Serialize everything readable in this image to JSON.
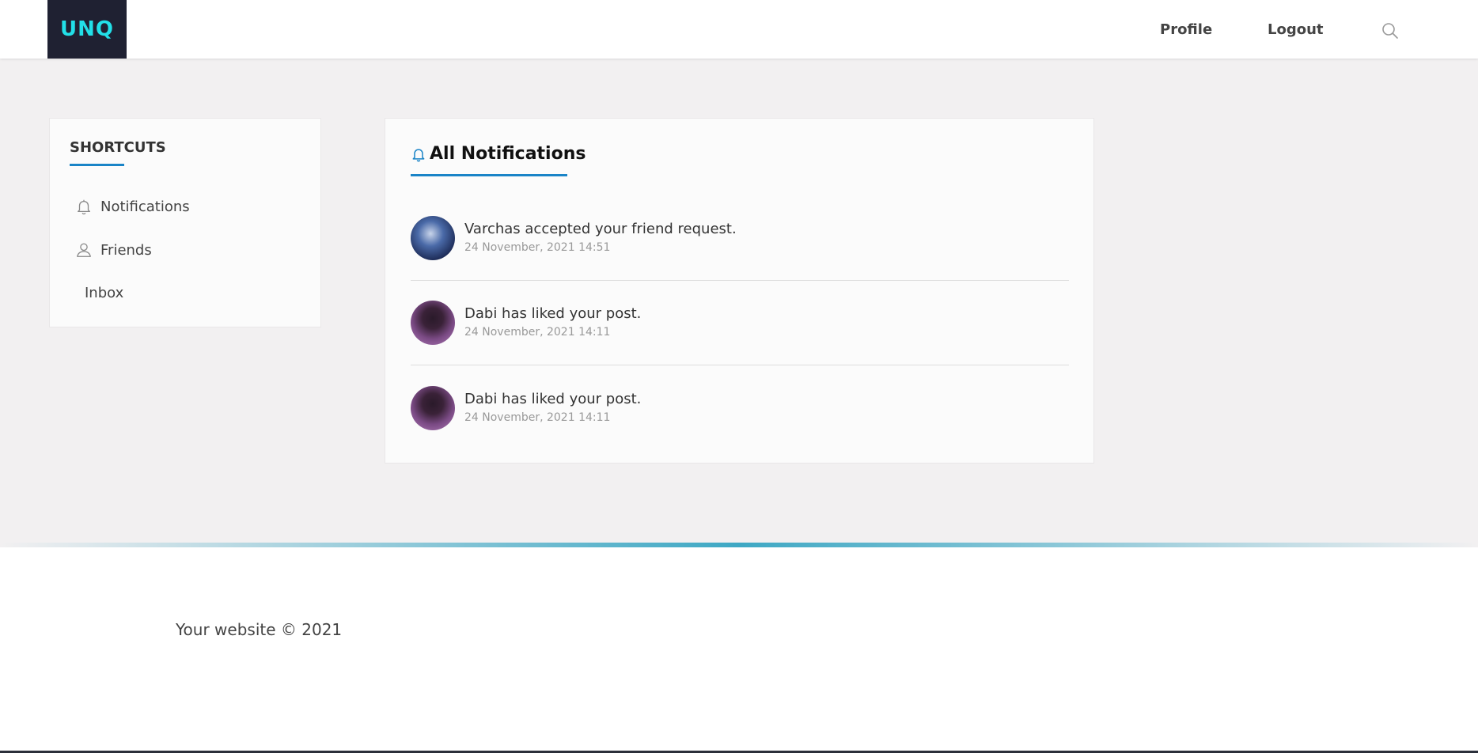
{
  "header": {
    "logo_text": "UNQ",
    "nav": {
      "profile_label": "Profile",
      "logout_label": "Logout"
    },
    "search_icon": "search-icon"
  },
  "sidebar": {
    "title": "SHORTCUTS",
    "items": [
      {
        "label": "Notifications",
        "icon": "bell-icon"
      },
      {
        "label": "Friends",
        "icon": "user-icon"
      },
      {
        "label": "Inbox",
        "icon": ""
      }
    ]
  },
  "notifications": {
    "title": "All Notifications",
    "items": [
      {
        "text": "Varchas accepted your friend request.",
        "time": "24 November, 2021 14:51"
      },
      {
        "text": "Dabi has liked your post.",
        "time": "24 November, 2021 14:11"
      },
      {
        "text": "Dabi has liked your post.",
        "time": "24 November, 2021 14:11"
      }
    ]
  },
  "footer": {
    "text": "Your website © 2021"
  },
  "colors": {
    "accent": "#1a84c7",
    "logo_bg": "#1f2132",
    "logo_text": "#22e0e8",
    "page_bg": "#f2f0f1"
  }
}
